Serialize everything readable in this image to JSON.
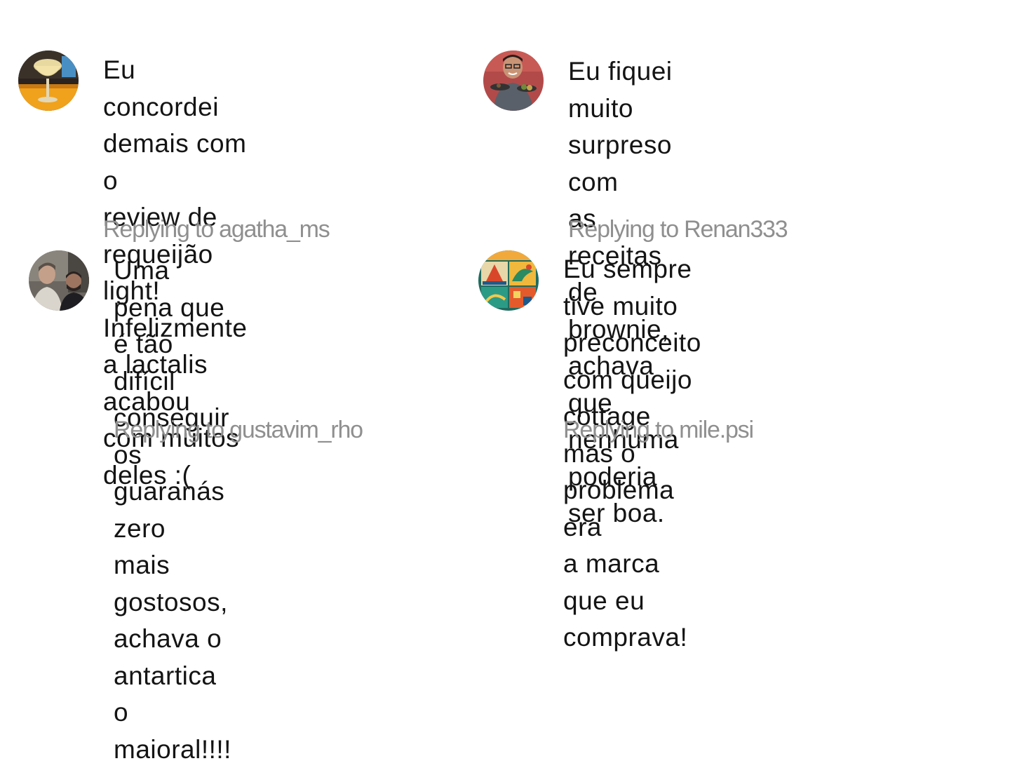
{
  "comments": [
    {
      "avatar": "drink-glass-avatar",
      "text": "Eu concordei demais com o\nreview de requeijão light!\nInfelizmente a lactalis\nacabou com muitos deles :(",
      "reply_prefix": "Replying to",
      "reply_user": "agatha_ms"
    },
    {
      "avatar": "man-holding-plates-avatar",
      "text": "Eu fiquei muito surpreso com\nas receitas de brownie,\nachava que nenhuma poderia\nser boa.",
      "reply_prefix": "Replying to",
      "reply_user": "Renan333"
    },
    {
      "avatar": "two-people-avatar",
      "text": "Uma pena que é tão difícil\nconseguir os guaranás zero\nmais gostosos, achava o\nantartica o maioral!!!!",
      "reply_prefix": "Replying to",
      "reply_user": "gustavim_rho"
    },
    {
      "avatar": "colorful-illustration-avatar",
      "text": "Eu sempre tive muito\npreconceito com queijo\ncottage mas o problema era\na marca que eu comprava!",
      "reply_prefix": "Replying to",
      "reply_user": "mile.psi"
    }
  ],
  "colors": {
    "text": "#141414",
    "reply": "#8f8f8f",
    "background": "#ffffff"
  }
}
